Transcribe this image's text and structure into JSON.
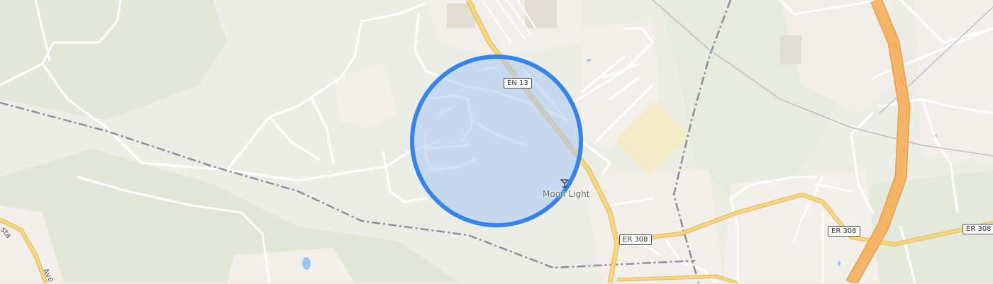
{
  "roads": {
    "en13": "EN 13",
    "er308_a": "ER 308",
    "er308_b": "ER 308",
    "er308_c": "ER 308",
    "street_left_a": "sta",
    "street_left_b": "Ave"
  },
  "poi": {
    "name": "Moon Light",
    "icon": "cocktail-bar-icon"
  },
  "colors": {
    "land": "#eceee6",
    "forest": "#dfe4d4",
    "urban": "#f1eee9",
    "motorway": "#f5b567",
    "primary": "#f7d77c",
    "minor": "#ffffff",
    "rail": "#8e8e9c",
    "water": "#9cc7ef",
    "accuracy_fill": "#aac8f5",
    "accuracy_stroke": "#3583ec"
  }
}
